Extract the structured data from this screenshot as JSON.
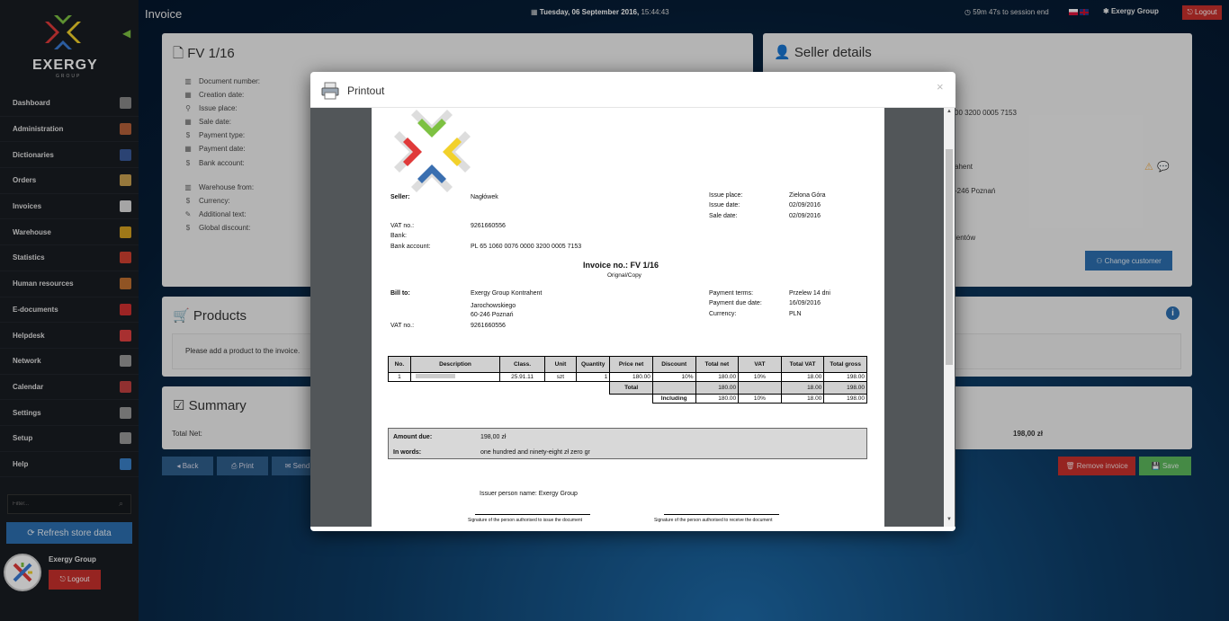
{
  "brand": {
    "name": "EXERGY",
    "sub": "GROUP"
  },
  "topbar": {
    "title": "Invoice",
    "date": "Tuesday, 06 September 2016,",
    "time": "15:44:43",
    "session": "59m 47s to session end",
    "company": "Exergy Group",
    "logout": "Logout"
  },
  "menu": [
    {
      "label": "Dashboard",
      "icon": "home-icon",
      "color": "#888"
    },
    {
      "label": "Administration",
      "icon": "books-icon",
      "color": "#b5603a"
    },
    {
      "label": "Dictionaries",
      "icon": "book-icon",
      "color": "#3a5a9a"
    },
    {
      "label": "Orders",
      "icon": "box-icon",
      "color": "#c8a050"
    },
    {
      "label": "Invoices",
      "icon": "document-icon",
      "color": "#ddd"
    },
    {
      "label": "Warehouse",
      "icon": "forklift-icon",
      "color": "#d4a020"
    },
    {
      "label": "Statistics",
      "icon": "pie-chart-icon",
      "color": "#d04030"
    },
    {
      "label": "Human resources",
      "icon": "person-icon",
      "color": "#c07030"
    },
    {
      "label": "E-documents",
      "icon": "pdf-icon",
      "color": "#d03030"
    },
    {
      "label": "Helpdesk",
      "icon": "lifebuoy-icon",
      "color": "#e04040"
    },
    {
      "label": "Network",
      "icon": "network-icon",
      "color": "#999"
    },
    {
      "label": "Calendar",
      "icon": "calendar-icon",
      "color": "#c04040"
    },
    {
      "label": "Settings",
      "icon": "gear-icon",
      "color": "#999"
    },
    {
      "label": "Setup",
      "icon": "setup-icon",
      "color": "#999"
    },
    {
      "label": "Help",
      "icon": "help-icon",
      "color": "#3a80c8"
    }
  ],
  "sidebar": {
    "filter_placeholder": "Filter...",
    "refresh": "Refresh store data",
    "user": "Exergy Group",
    "logout": "Logout"
  },
  "invoice_panel": {
    "title": "FV 1/16",
    "fields": [
      "Document number:",
      "Creation date:",
      "Issue place:",
      "Sale date:",
      "Payment type:",
      "Payment date:",
      "Bank account:",
      "Warehouse from:",
      "Currency:",
      "Additional text:",
      "Global discount:"
    ]
  },
  "seller_panel": {
    "title": "Seller details",
    "account_fragment": "00 3200 0005 7153",
    "customer_fragment": "ahent",
    "city_fragment": "-246 Poznań",
    "notes_fragment": "ientów",
    "change_customer": "Change customer"
  },
  "products_panel": {
    "title": "Products",
    "empty": "Please add a product to the invoice."
  },
  "summary_panel": {
    "title": "Summary",
    "total_net_label": "Total Net:",
    "total_value": "198,00 zł"
  },
  "actions": {
    "back": "Back",
    "print": "Print",
    "send": "Send",
    "remove": "Remove invoice",
    "save": "Save"
  },
  "modal": {
    "title": "Printout",
    "close": "×"
  },
  "doc": {
    "seller_label": "Seller:",
    "seller": "Nagłówek",
    "vat_label": "VAT no.:",
    "vat": "9261660556",
    "bank_label": "Bank:",
    "bank_account_label": "Bank account:",
    "bank_account": "PL 65 1060 0076 0000 3200 0005 7153",
    "issue_place_label": "Issue place:",
    "issue_place": "Zielona Góra",
    "issue_date_label": "Issue date:",
    "issue_date": "02/09/2016",
    "sale_date_label": "Sale date:",
    "sale_date": "02/09/2016",
    "invoice_no": "Invoice no.: FV 1/16",
    "original": "Orignal/Copy",
    "bill_to_label": "Bill to:",
    "bill_to_name": "Exergy Group Kontrahent",
    "bill_to_street": "Jarochowskiego",
    "bill_to_city": "60-246 Poznań",
    "bill_vat_label": "VAT no.:",
    "bill_vat": "9261660556",
    "terms_label": "Payment terms:",
    "terms": "Przelew 14 dni",
    "due_label": "Payment due date:",
    "due": "16/09/2016",
    "currency_label": "Currency:",
    "currency": "PLN",
    "headers": [
      "No.",
      "Description",
      "Class.",
      "Unit",
      "Quantity",
      "Price net",
      "Discount",
      "Total net",
      "VAT",
      "Total VAT",
      "Total gross"
    ],
    "row": {
      "no": "1",
      "class": "25.91.11",
      "unit": "szt",
      "qty": "1",
      "price": "180.00",
      "discount": "10%",
      "net": "180.00",
      "vat": "10%",
      "tvat": "18.00",
      "gross": "198.00"
    },
    "total_label": "Total",
    "total": {
      "net": "180.00",
      "tvat": "18.00",
      "gross": "198.00"
    },
    "including_label": "Including",
    "including": {
      "net": "180.00",
      "vat": "10%",
      "tvat": "18.00",
      "gross": "198.00"
    },
    "amount_due_label": "Amount due:",
    "amount_due": "198,00 zł",
    "in_words_label": "In words:",
    "in_words": "one hundred and ninety-eight zł zero gr",
    "issuer": "Issuer person name: Exergy Group",
    "sig1": "Signature of the person authorised to issue the document",
    "sig2": "Signature of the person authorised to receive the document"
  }
}
